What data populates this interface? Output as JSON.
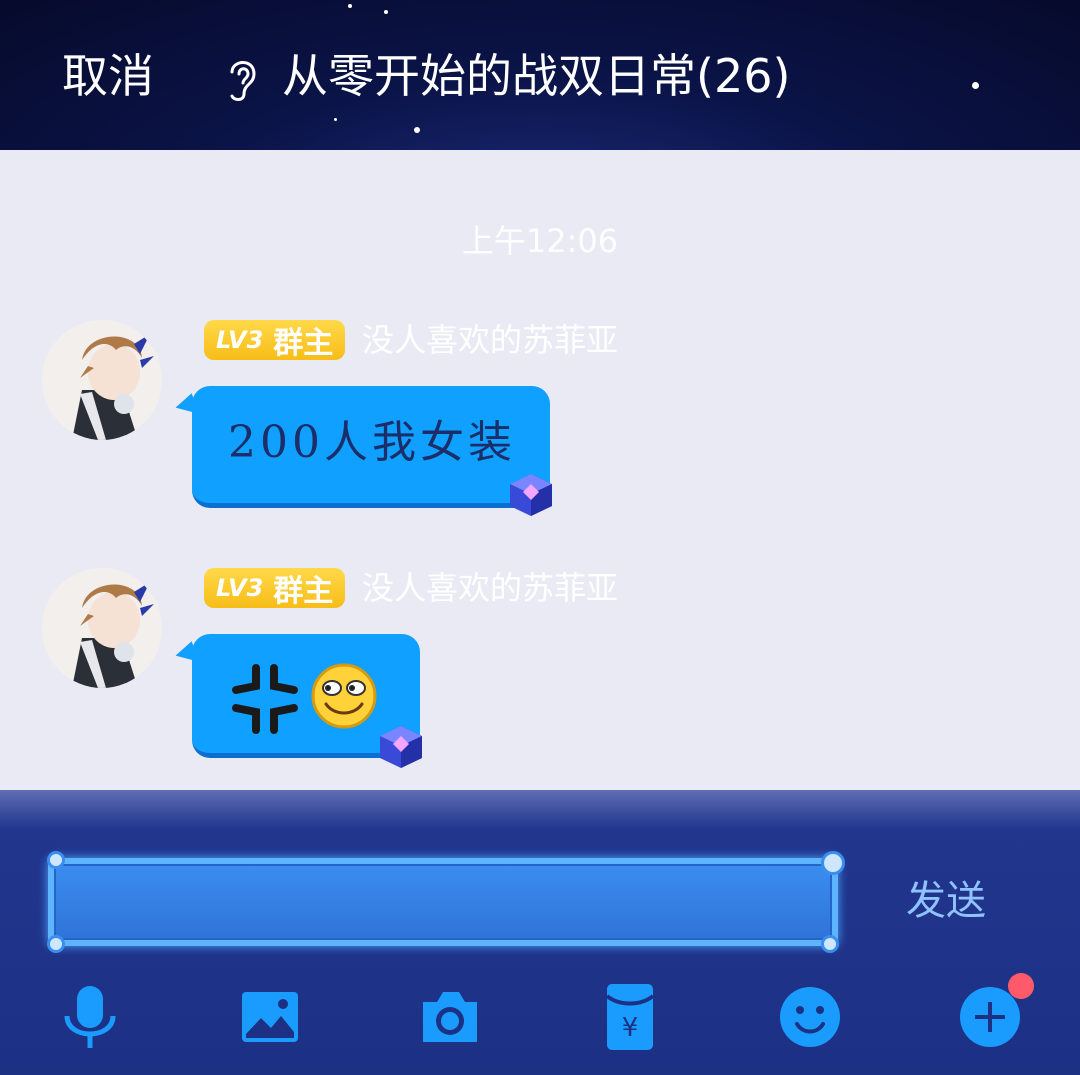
{
  "header": {
    "cancel_label": "取消",
    "title": "从零开始的战双日常(26)"
  },
  "chat": {
    "timestamp": "上午12:06",
    "messages": [
      {
        "level": "LV3",
        "role": "群主",
        "sender": "没人喜欢的苏菲亚",
        "text": "200人我女装"
      },
      {
        "level": "LV3",
        "role": "群主",
        "sender": "没人喜欢的苏菲亚",
        "text": ""
      }
    ]
  },
  "input": {
    "value": "",
    "send_label": "发送"
  },
  "toolbar": {
    "icons": [
      "microphone-icon",
      "image-icon",
      "camera-icon",
      "red-packet-icon",
      "emoji-icon",
      "plus-icon"
    ]
  },
  "colors": {
    "header_bg": "#0b1448",
    "bubble": "#10a0ff",
    "badge": "#f7bd18",
    "input_bar": "#1c3084",
    "tool_blue": "#1a9cff",
    "notify_dot": "#ff5a6a"
  }
}
